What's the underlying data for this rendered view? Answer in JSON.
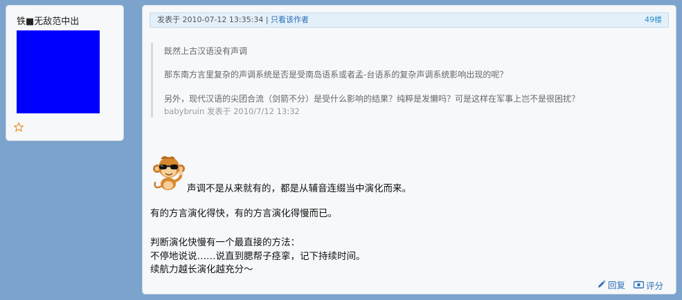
{
  "user": {
    "name": "铁■无敌范中出",
    "avatar_color": "#0000ff",
    "icon": "star-icon"
  },
  "post": {
    "posted_at": "发表于 2010-07-12 13:35:34",
    "separator": "|",
    "only_author": "只看该作者",
    "floor": "49楼",
    "quote": {
      "line1": "既然上古汉语没有声调",
      "line2": "那东南方言里复杂的声调系统是否是受南岛语系或者孟-台语系的复杂声调系统影响出现的呢？",
      "line3": "另外，现代汉语的尖团合流（剑箭不分）是受什么影响的结果？纯粹是发懒吗？可是这样在军事上岂不是很困扰？",
      "attribution": "babybruin 发表于 2010/7/12 13:32"
    },
    "body": {
      "line1": "声调不是从来就有的，都是从辅音连缀当中演化而来。",
      "line2": "有的方言演化得快，有的方言演化得慢而已。",
      "line3": "判断演化快慢有一个最直接的方法：",
      "line4": "不停地说说……说直到腮帮子痉挛，记下持续时间。",
      "line5": "续航力越长演化越充分～"
    },
    "emoji_icon": "cool-monkey-icon",
    "actions": {
      "reply": "回复",
      "rate": "评分"
    }
  }
}
